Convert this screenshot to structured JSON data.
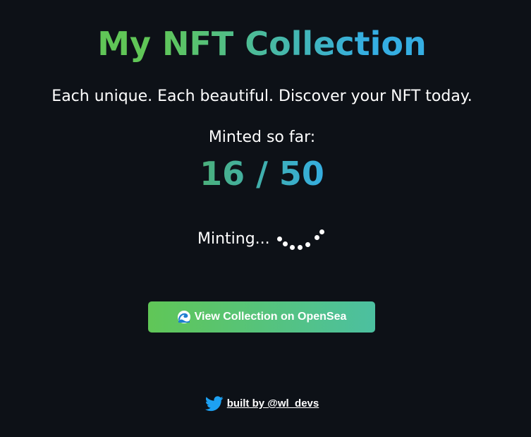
{
  "header": {
    "title": "My NFT Collection",
    "subtitle": "Each unique. Each beautiful. Discover your NFT today."
  },
  "mint_status": {
    "label": "Minted so far:",
    "count_text": "16 / 50",
    "minted": 16,
    "total": 50,
    "progress_text": "Minting..."
  },
  "actions": {
    "view_collection_label": "View Collection on OpenSea",
    "view_collection_icon": "wave-icon"
  },
  "footer": {
    "icon": "twitter-icon",
    "link_text": "built by @wl_devs"
  },
  "colors": {
    "background": "#0d1117",
    "gradient_green": "#60c657",
    "gradient_blue": "#35aee2",
    "button_gradient_end": "#4cc0a0",
    "twitter_blue": "#1da1f2"
  }
}
